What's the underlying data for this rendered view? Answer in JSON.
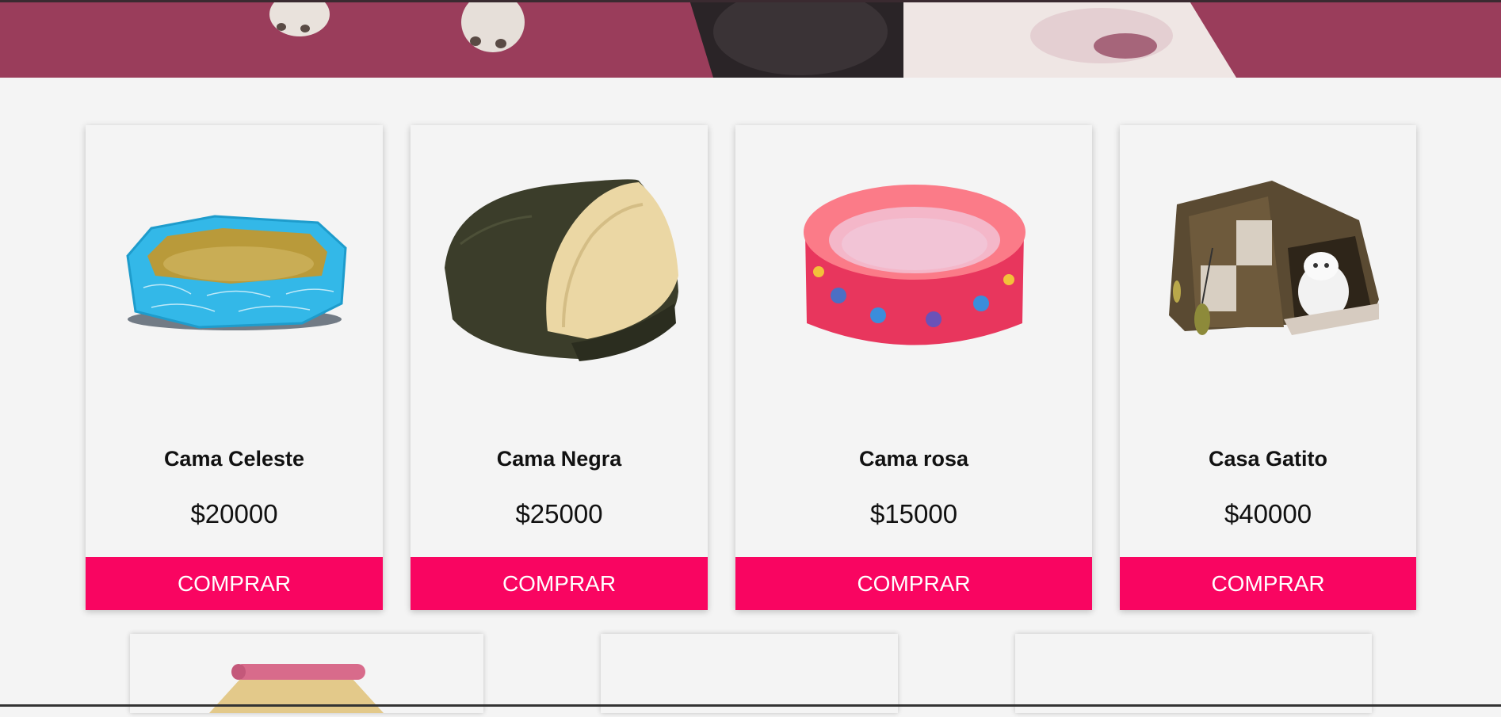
{
  "products": [
    {
      "name": "Cama Celeste",
      "price": "$20000",
      "button": "COMPRAR",
      "image_icon": "blue-pet-bed-icon"
    },
    {
      "name": "Cama Negra",
      "price": "$25000",
      "button": "COMPRAR",
      "image_icon": "black-cave-pet-bed-icon"
    },
    {
      "name": "Cama rosa",
      "price": "$15000",
      "button": "COMPRAR",
      "image_icon": "pink-pet-bed-icon"
    },
    {
      "name": "Casa Gatito",
      "price": "$40000",
      "button": "COMPRAR",
      "image_icon": "cat-house-icon"
    }
  ],
  "colors": {
    "accent": "#f90561",
    "banner": "#9a3d5b",
    "background": "#f4f4f4"
  }
}
